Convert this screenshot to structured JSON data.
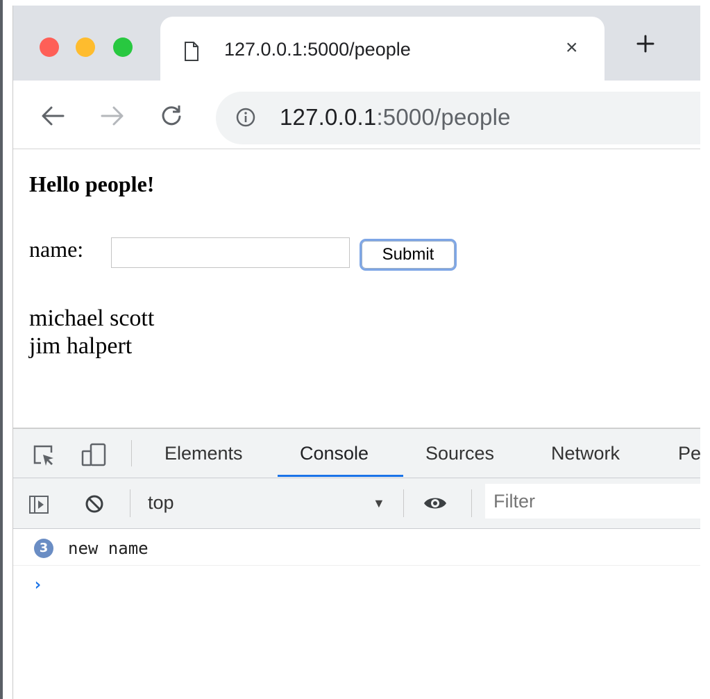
{
  "browser": {
    "tab_title": "127.0.0.1:5000/people",
    "tab_close": "×",
    "new_tab": "+",
    "address": {
      "host": "127.0.0.1",
      "rest": ":5000/people"
    },
    "icons": {
      "back": "arrow-left-icon",
      "forward": "arrow-right-icon",
      "reload": "reload-icon",
      "info": "info-icon",
      "tab": "document-icon"
    }
  },
  "page": {
    "heading": "Hello people!",
    "form": {
      "label": "name:",
      "input_value": "",
      "submit_label": "Submit"
    },
    "people": [
      "michael scott",
      "jim halpert"
    ]
  },
  "devtools": {
    "tabs": [
      {
        "label": "Elements",
        "active": false
      },
      {
        "label": "Console",
        "active": true
      },
      {
        "label": "Sources",
        "active": false
      },
      {
        "label": "Network",
        "active": false
      },
      {
        "label": "Pe",
        "active": false
      }
    ],
    "console_bar": {
      "context": "top",
      "filter_placeholder": "Filter"
    },
    "messages": [
      {
        "count": "3",
        "text": "new name"
      }
    ],
    "prompt": "›"
  },
  "colors": {
    "accent": "#1a73e8",
    "tab_strip": "#dee1e6",
    "badge": "#6a8dc4"
  }
}
